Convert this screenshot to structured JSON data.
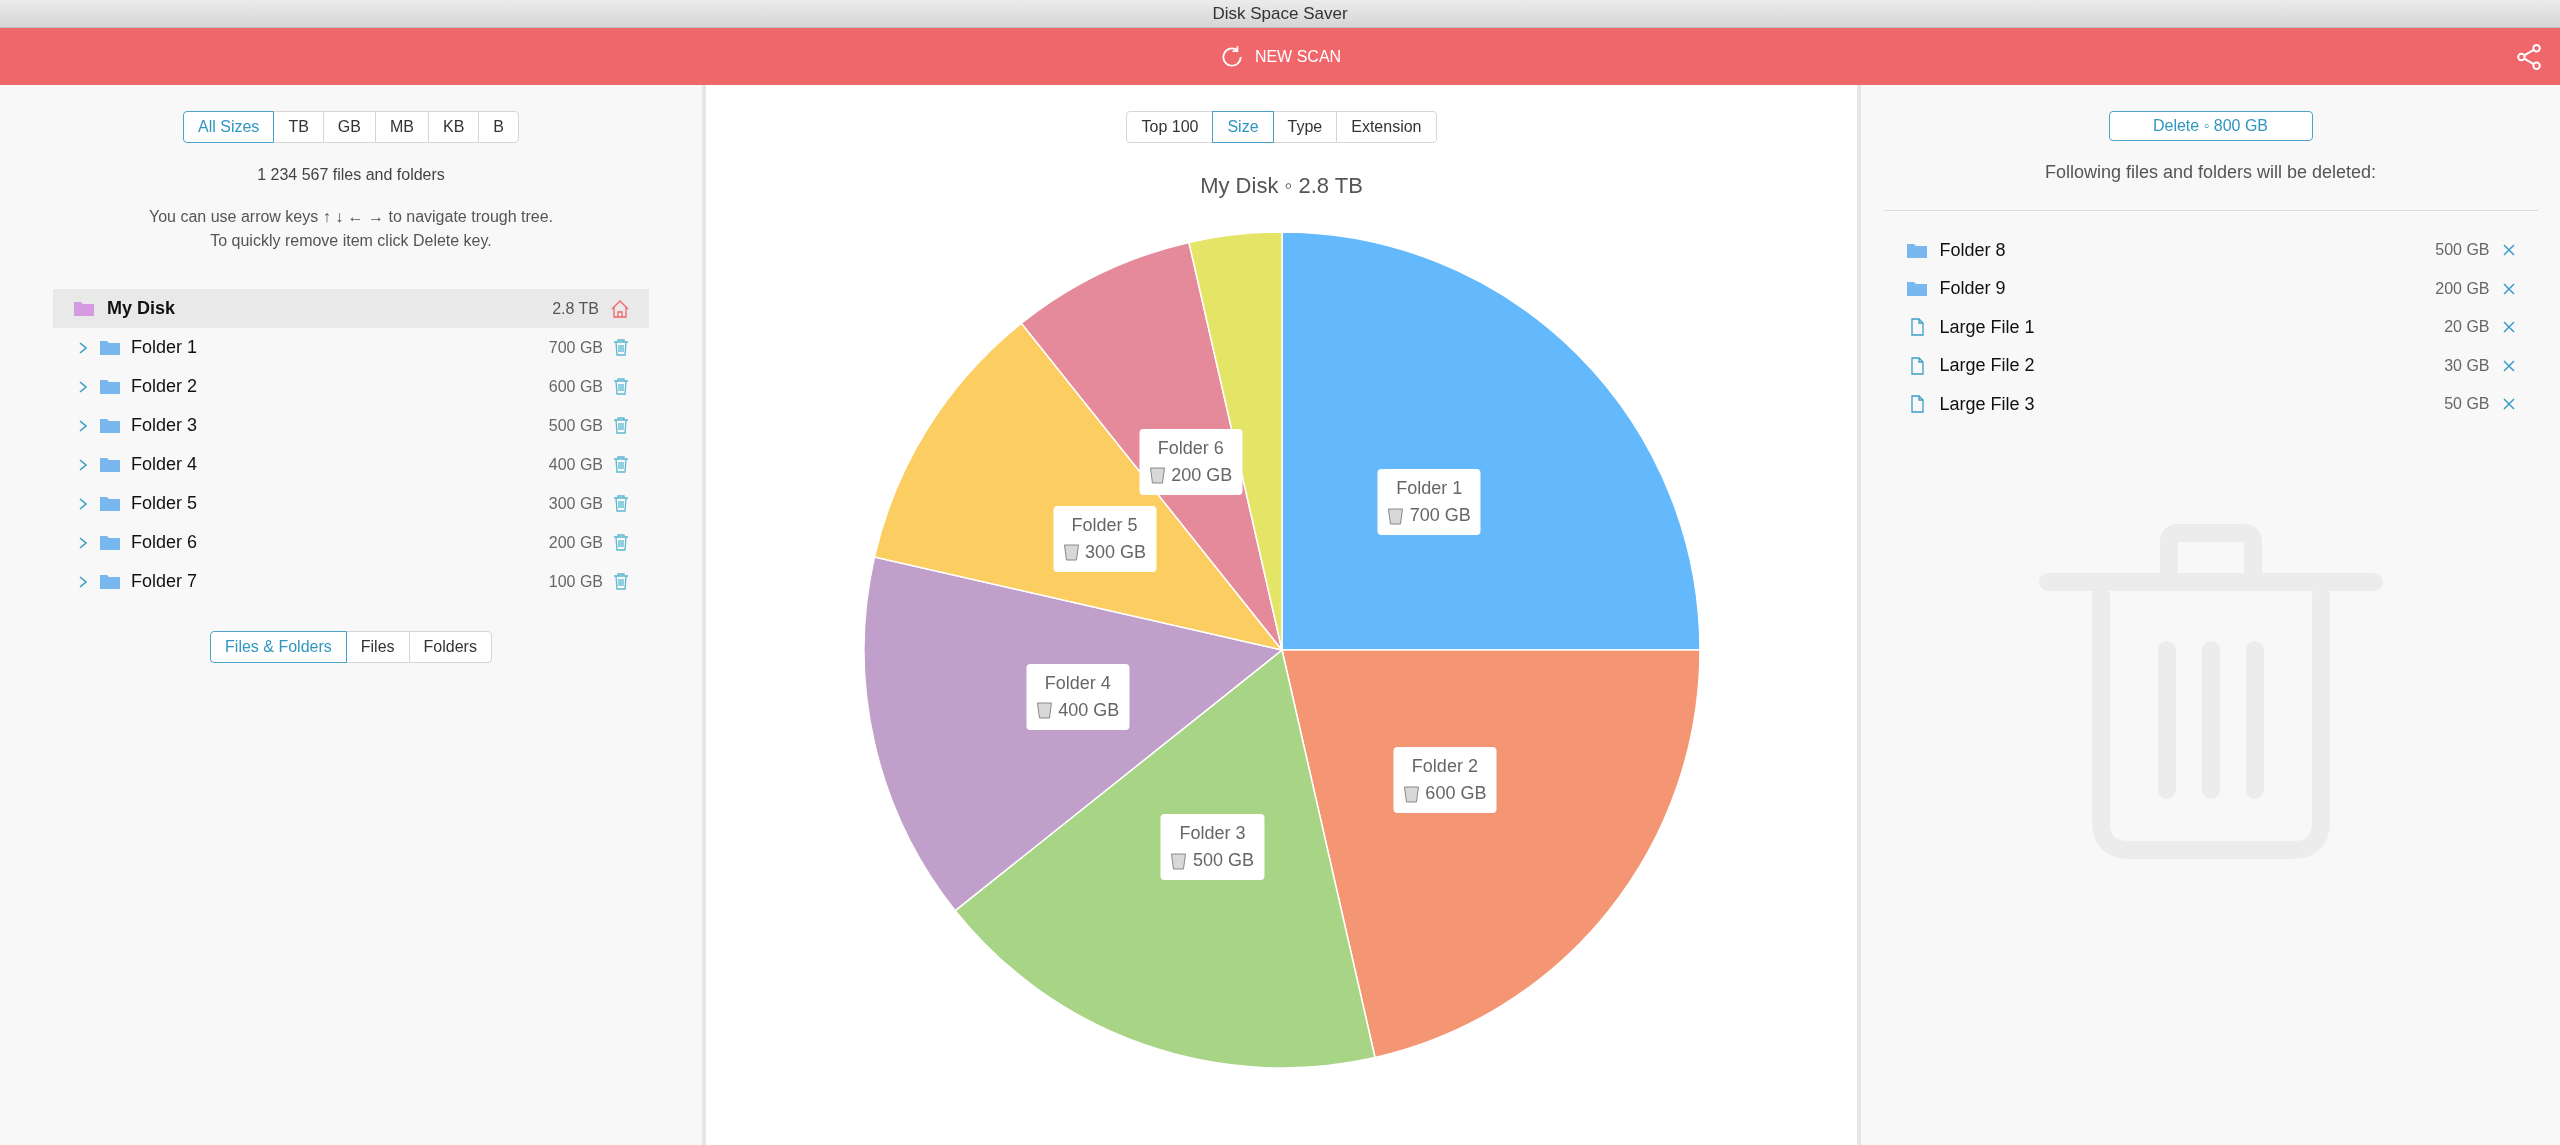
{
  "window": {
    "title": "Disk Space Saver"
  },
  "toolbar": {
    "scan_button": "NEW SCAN"
  },
  "left_panel": {
    "size_filters": [
      {
        "label": "All Sizes",
        "selected": true
      },
      {
        "label": "TB",
        "selected": false
      },
      {
        "label": "GB",
        "selected": false
      },
      {
        "label": "MB",
        "selected": false
      },
      {
        "label": "KB",
        "selected": false
      },
      {
        "label": "B",
        "selected": false
      }
    ],
    "count": "1 234 567 files and folders",
    "hint_lines": [
      "You can use arrow keys ↑ ↓ ← → to navigate trough tree.",
      "To quickly remove item click Delete key."
    ],
    "tree": {
      "name": "My Disk",
      "size": "2.8 TB",
      "selected": true,
      "children": [
        {
          "name": "Folder 1",
          "size": "700 GB",
          "expanded": false,
          "selected": false
        },
        {
          "name": "Folder 2",
          "size": "600 GB",
          "expanded": false,
          "selected": false
        },
        {
          "name": "Folder 3",
          "size": "500 GB",
          "expanded": false,
          "selected": false
        },
        {
          "name": "Folder 4",
          "size": "400 GB",
          "expanded": false,
          "selected": false
        },
        {
          "name": "Folder 5",
          "size": "300 GB",
          "expanded": false,
          "selected": false
        },
        {
          "name": "Folder 6",
          "size": "200 GB",
          "expanded": false,
          "selected": false
        },
        {
          "name": "Folder 7",
          "size": "100 GB",
          "expanded": false,
          "selected": false
        }
      ]
    },
    "type_filters": [
      {
        "label": "Files & Folders",
        "selected": true
      },
      {
        "label": "Files",
        "selected": false
      },
      {
        "label": "Folders",
        "selected": false
      }
    ]
  },
  "center_panel": {
    "view_tabs": [
      {
        "label": "Top 100",
        "selected": false
      },
      {
        "label": "Size",
        "selected": true
      },
      {
        "label": "Type",
        "selected": false
      },
      {
        "label": "Extension",
        "selected": false
      }
    ],
    "chart_data": {
      "type": "pie",
      "title": "My Disk ◦ 2.8 TB",
      "categories": [
        "Folder 1",
        "Folder 2",
        "Folder 3",
        "Folder 4",
        "Folder 5",
        "Folder 6",
        null
      ],
      "values": [
        700,
        600,
        500,
        400,
        300,
        200,
        100
      ],
      "colors": [
        "#63b9fb",
        "#f49673",
        "#a8d585",
        "#c09fca",
        "#fcce61",
        "#e58a9b",
        "#e4e466"
      ],
      "value_labels": [
        "700 GB",
        "600 GB",
        "500 GB",
        "400 GB",
        "300 GB",
        "200 GB",
        null
      ]
    }
  },
  "right_panel": {
    "delete_button": "Delete ◦ 800 GB",
    "caption": "Following files and folders will be deleted:",
    "items": [
      {
        "kind": "folder",
        "name": "Folder 8",
        "size": "500 GB"
      },
      {
        "kind": "folder",
        "name": "Folder 9",
        "size": "200 GB"
      },
      {
        "kind": "file",
        "name": "Large File 1",
        "size": "20 GB"
      },
      {
        "kind": "file",
        "name": "Large File 2",
        "size": "30 GB"
      },
      {
        "kind": "file",
        "name": "Large File 3",
        "size": "50 GB"
      }
    ]
  }
}
